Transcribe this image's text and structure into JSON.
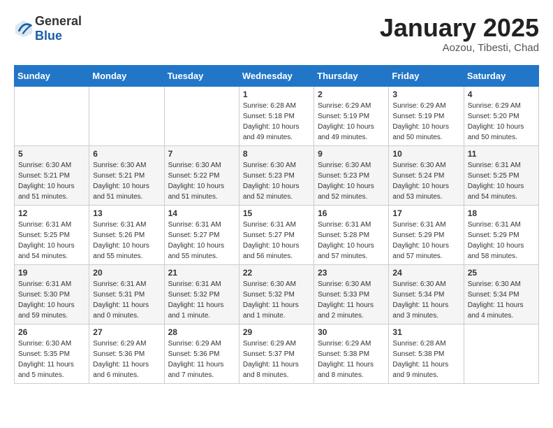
{
  "header": {
    "logo_general": "General",
    "logo_blue": "Blue",
    "month_title": "January 2025",
    "location": "Aozou, Tibesti, Chad"
  },
  "weekdays": [
    "Sunday",
    "Monday",
    "Tuesday",
    "Wednesday",
    "Thursday",
    "Friday",
    "Saturday"
  ],
  "weeks": [
    [
      {
        "day": "",
        "info": ""
      },
      {
        "day": "",
        "info": ""
      },
      {
        "day": "",
        "info": ""
      },
      {
        "day": "1",
        "info": "Sunrise: 6:28 AM\nSunset: 5:18 PM\nDaylight: 10 hours\nand 49 minutes."
      },
      {
        "day": "2",
        "info": "Sunrise: 6:29 AM\nSunset: 5:19 PM\nDaylight: 10 hours\nand 49 minutes."
      },
      {
        "day": "3",
        "info": "Sunrise: 6:29 AM\nSunset: 5:19 PM\nDaylight: 10 hours\nand 50 minutes."
      },
      {
        "day": "4",
        "info": "Sunrise: 6:29 AM\nSunset: 5:20 PM\nDaylight: 10 hours\nand 50 minutes."
      }
    ],
    [
      {
        "day": "5",
        "info": "Sunrise: 6:30 AM\nSunset: 5:21 PM\nDaylight: 10 hours\nand 51 minutes."
      },
      {
        "day": "6",
        "info": "Sunrise: 6:30 AM\nSunset: 5:21 PM\nDaylight: 10 hours\nand 51 minutes."
      },
      {
        "day": "7",
        "info": "Sunrise: 6:30 AM\nSunset: 5:22 PM\nDaylight: 10 hours\nand 51 minutes."
      },
      {
        "day": "8",
        "info": "Sunrise: 6:30 AM\nSunset: 5:23 PM\nDaylight: 10 hours\nand 52 minutes."
      },
      {
        "day": "9",
        "info": "Sunrise: 6:30 AM\nSunset: 5:23 PM\nDaylight: 10 hours\nand 52 minutes."
      },
      {
        "day": "10",
        "info": "Sunrise: 6:30 AM\nSunset: 5:24 PM\nDaylight: 10 hours\nand 53 minutes."
      },
      {
        "day": "11",
        "info": "Sunrise: 6:31 AM\nSunset: 5:25 PM\nDaylight: 10 hours\nand 54 minutes."
      }
    ],
    [
      {
        "day": "12",
        "info": "Sunrise: 6:31 AM\nSunset: 5:25 PM\nDaylight: 10 hours\nand 54 minutes."
      },
      {
        "day": "13",
        "info": "Sunrise: 6:31 AM\nSunset: 5:26 PM\nDaylight: 10 hours\nand 55 minutes."
      },
      {
        "day": "14",
        "info": "Sunrise: 6:31 AM\nSunset: 5:27 PM\nDaylight: 10 hours\nand 55 minutes."
      },
      {
        "day": "15",
        "info": "Sunrise: 6:31 AM\nSunset: 5:27 PM\nDaylight: 10 hours\nand 56 minutes."
      },
      {
        "day": "16",
        "info": "Sunrise: 6:31 AM\nSunset: 5:28 PM\nDaylight: 10 hours\nand 57 minutes."
      },
      {
        "day": "17",
        "info": "Sunrise: 6:31 AM\nSunset: 5:29 PM\nDaylight: 10 hours\nand 57 minutes."
      },
      {
        "day": "18",
        "info": "Sunrise: 6:31 AM\nSunset: 5:29 PM\nDaylight: 10 hours\nand 58 minutes."
      }
    ],
    [
      {
        "day": "19",
        "info": "Sunrise: 6:31 AM\nSunset: 5:30 PM\nDaylight: 10 hours\nand 59 minutes."
      },
      {
        "day": "20",
        "info": "Sunrise: 6:31 AM\nSunset: 5:31 PM\nDaylight: 11 hours\nand 0 minutes."
      },
      {
        "day": "21",
        "info": "Sunrise: 6:31 AM\nSunset: 5:32 PM\nDaylight: 11 hours\nand 1 minute."
      },
      {
        "day": "22",
        "info": "Sunrise: 6:30 AM\nSunset: 5:32 PM\nDaylight: 11 hours\nand 1 minute."
      },
      {
        "day": "23",
        "info": "Sunrise: 6:30 AM\nSunset: 5:33 PM\nDaylight: 11 hours\nand 2 minutes."
      },
      {
        "day": "24",
        "info": "Sunrise: 6:30 AM\nSunset: 5:34 PM\nDaylight: 11 hours\nand 3 minutes."
      },
      {
        "day": "25",
        "info": "Sunrise: 6:30 AM\nSunset: 5:34 PM\nDaylight: 11 hours\nand 4 minutes."
      }
    ],
    [
      {
        "day": "26",
        "info": "Sunrise: 6:30 AM\nSunset: 5:35 PM\nDaylight: 11 hours\nand 5 minutes."
      },
      {
        "day": "27",
        "info": "Sunrise: 6:29 AM\nSunset: 5:36 PM\nDaylight: 11 hours\nand 6 minutes."
      },
      {
        "day": "28",
        "info": "Sunrise: 6:29 AM\nSunset: 5:36 PM\nDaylight: 11 hours\nand 7 minutes."
      },
      {
        "day": "29",
        "info": "Sunrise: 6:29 AM\nSunset: 5:37 PM\nDaylight: 11 hours\nand 8 minutes."
      },
      {
        "day": "30",
        "info": "Sunrise: 6:29 AM\nSunset: 5:38 PM\nDaylight: 11 hours\nand 8 minutes."
      },
      {
        "day": "31",
        "info": "Sunrise: 6:28 AM\nSunset: 5:38 PM\nDaylight: 11 hours\nand 9 minutes."
      },
      {
        "day": "",
        "info": ""
      }
    ]
  ]
}
